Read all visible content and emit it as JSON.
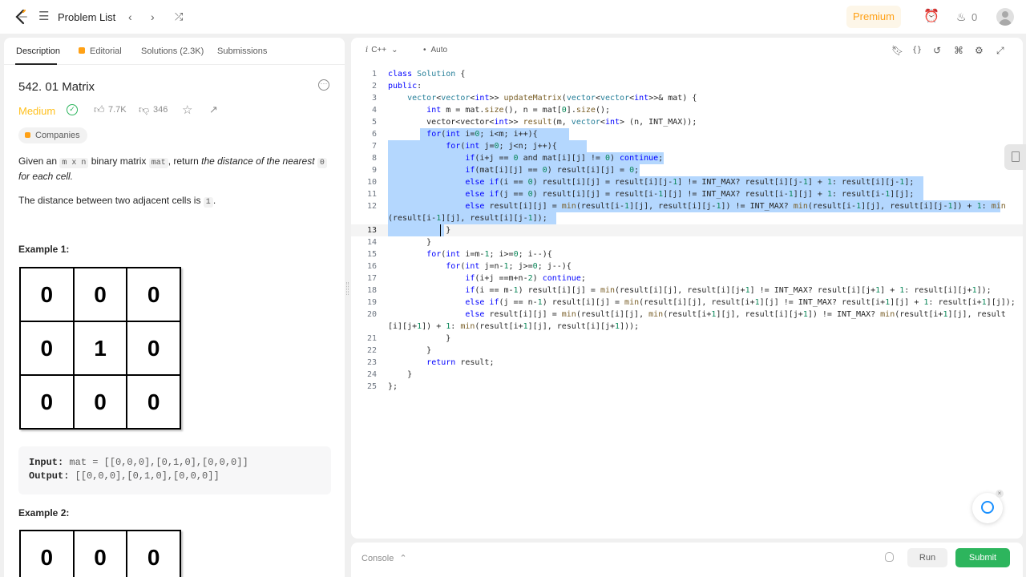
{
  "topbar": {
    "problem_list": "Problem List",
    "premium": "Premium",
    "streak_count": "0"
  },
  "tabs": {
    "description": "Description",
    "editorial": "Editorial",
    "solutions": "Solutions (2.3K)",
    "submissions": "Submissions"
  },
  "problem": {
    "title": "542. 01 Matrix",
    "difficulty": "Medium",
    "likes": "7.7K",
    "dislikes": "346",
    "companies": "Companies",
    "desc_p1_a": "Given an ",
    "desc_p1_code1": "m x n",
    "desc_p1_b": " binary matrix ",
    "desc_p1_code2": "mat",
    "desc_p1_c": ", return ",
    "desc_p1_em1": "the distance of the nearest ",
    "desc_p1_code3": "0",
    "desc_p1_em2": " for each cell.",
    "desc_p2_a": "The distance between two adjacent cells is ",
    "desc_p2_code": "1",
    "desc_p2_b": ".",
    "example1_title": "Example 1:",
    "example1_grid": [
      [
        "0",
        "0",
        "0"
      ],
      [
        "0",
        "1",
        "0"
      ],
      [
        "0",
        "0",
        "0"
      ]
    ],
    "input_label": "Input:",
    "input_value": "mat = [[0,0,0],[0,1,0],[0,0,0]]",
    "output_label": "Output:",
    "output_value": "[[0,0,0],[0,1,0],[0,0,0]]",
    "example2_title": "Example 2:",
    "example2_grid": [
      [
        "0",
        "0",
        "0"
      ]
    ]
  },
  "editor": {
    "language": "C++",
    "mode": "Auto",
    "current_line": 13
  },
  "bottombar": {
    "console": "Console",
    "run": "Run",
    "submit": "Submit"
  },
  "colors": {
    "accent": "#ffa116",
    "medium": "#ffc01e",
    "submit": "#2db55d",
    "selection": "#b4d7fe"
  }
}
